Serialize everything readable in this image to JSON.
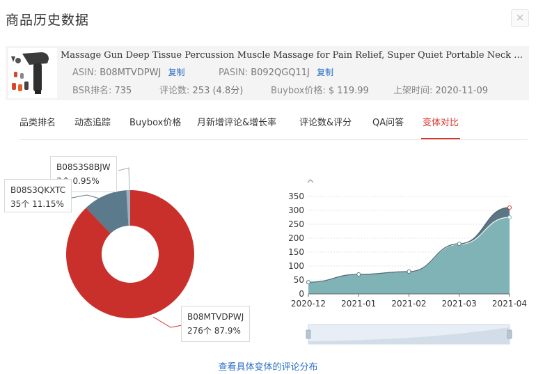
{
  "dialog": {
    "title": "商品历史数据",
    "close_label": "×"
  },
  "product": {
    "title": "Massage Gun Deep Tissue Percussion Muscle Massage for Pain Relief, Super Quiet Portable Neck Back Body Rela...",
    "asin_label": "ASIN:",
    "asin": "B08MTVDPWJ",
    "pasin_label": "PASIN:",
    "pasin": "B092QGQ11J",
    "copy_label": "复制",
    "bsr_label": "BSR排名:",
    "bsr": "735",
    "reviews_label": "评论数:",
    "reviews": "253 (4.8分)",
    "buybox_label": "Buybox价格:",
    "buybox": "$ 119.99",
    "listed_label": "上架时间:",
    "listed": "2020-11-09"
  },
  "tabs": [
    {
      "label": "品类排名",
      "active": false
    },
    {
      "label": "动态追踪",
      "active": false
    },
    {
      "label": "Buybox价格",
      "active": false
    },
    {
      "label": "月新增评论&增长率",
      "active": false
    },
    {
      "label": "评论数&评分",
      "active": false
    },
    {
      "label": "QA问答",
      "active": false
    },
    {
      "label": "变体对比",
      "active": true
    }
  ],
  "footer": {
    "link_label": "查看具体变体的评论分布"
  },
  "colors": {
    "accent_red": "#d9342b",
    "link_blue": "#2a6fc6",
    "slice_main": "#c9302c",
    "slice_second": "#5b7a8c",
    "slice_third": "#9ab0bd",
    "area_fill": "#7fb3b6",
    "area_dark": "#5d7684"
  },
  "chart_data": [
    {
      "type": "pie",
      "slices": [
        {
          "name": "B08MTVDPWJ",
          "count_label": "276个",
          "percent_label": "87.9%",
          "value": 276
        },
        {
          "name": "B08S3QKXTC",
          "count_label": "35个",
          "percent_label": "11.15%",
          "value": 35
        },
        {
          "name": "B08S3S8BJW",
          "count_label": "3个",
          "percent_label": "0.95%",
          "value": 3
        }
      ],
      "style": "donut"
    },
    {
      "type": "area",
      "categories": [
        "2020-12",
        "2021-01",
        "2021-02",
        "2021-03",
        "2021-04"
      ],
      "yticks": [
        0,
        50,
        100,
        150,
        200,
        250,
        300,
        350
      ],
      "ylim": [
        0,
        350
      ],
      "series": [
        {
          "values": [
            42,
            70,
            80,
            178,
            275
          ]
        },
        {
          "values": [
            42,
            70,
            80,
            180,
            310
          ]
        }
      ],
      "grid": true
    }
  ]
}
